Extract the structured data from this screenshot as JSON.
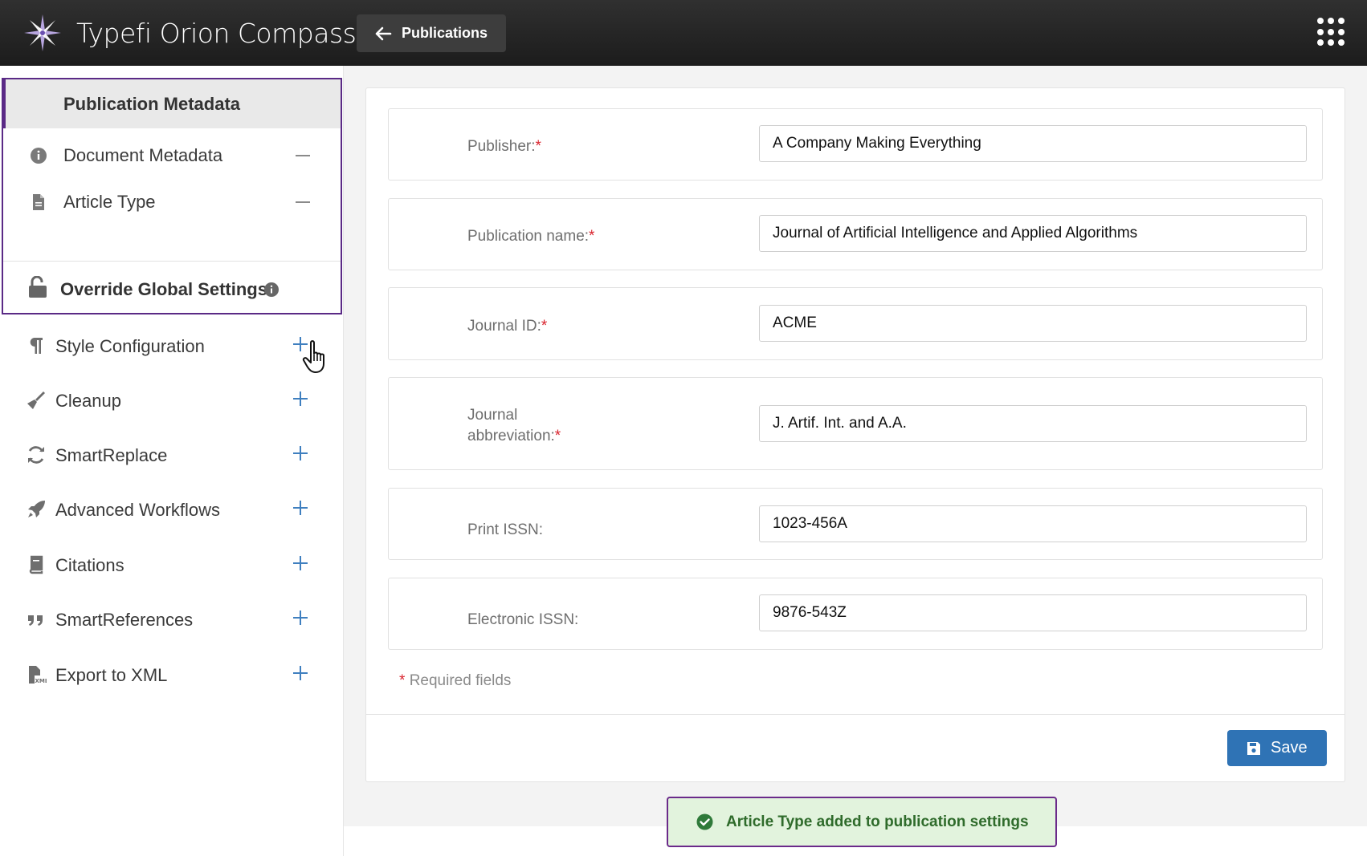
{
  "app": {
    "title": "Typefi Orion Compass",
    "back_button_label": "Publications",
    "apps_icon": "grid-dots-icon"
  },
  "sidebar": {
    "selected_header": "Publication Metadata",
    "sub_items": [
      {
        "label": "Document Metadata",
        "icon": "info-circle-icon",
        "action": "remove"
      },
      {
        "label": "Article Type",
        "icon": "document-icon",
        "action": "remove"
      }
    ],
    "override": {
      "label": "Override Global Settings",
      "icon": "unlock-icon"
    },
    "items": [
      {
        "label": "Style Configuration",
        "icon": "paragraph-icon"
      },
      {
        "label": "Cleanup",
        "icon": "broom-icon"
      },
      {
        "label": "SmartReplace",
        "icon": "refresh-icon"
      },
      {
        "label": "Advanced Workflows",
        "icon": "rocket-icon"
      },
      {
        "label": "Citations",
        "icon": "book-icon"
      },
      {
        "label": "SmartReferences",
        "icon": "quote-icon"
      },
      {
        "label": "Export to XML",
        "icon": "xml-file-icon"
      }
    ]
  },
  "form": {
    "fields": [
      {
        "label": "Publisher:",
        "required": "*",
        "value": "A Company Making Everything"
      },
      {
        "label": "Publication name:",
        "required": "*",
        "value": "Journal of Artificial Intelligence and Applied Algorithms"
      },
      {
        "label": "Journal ID:",
        "required": "*",
        "value": "ACME"
      },
      {
        "label_line1": "Journal",
        "label_line2": "abbreviation:",
        "required": "*",
        "value": "J. Artif. Int. and A.A."
      },
      {
        "label": "Print ISSN:",
        "required": "",
        "value": "1023-456A"
      },
      {
        "label": "Electronic ISSN:",
        "required": "",
        "value": "9876-543Z"
      }
    ],
    "required_marker": "*",
    "required_note": "Required fields",
    "save_label": "Save"
  },
  "toast": {
    "message": "Article Type added to publication settings",
    "color": "#2f6b2b"
  },
  "colors": {
    "accent_purple": "#5a2a86",
    "primary_blue": "#2f73b5",
    "required_red": "#d9232d"
  }
}
